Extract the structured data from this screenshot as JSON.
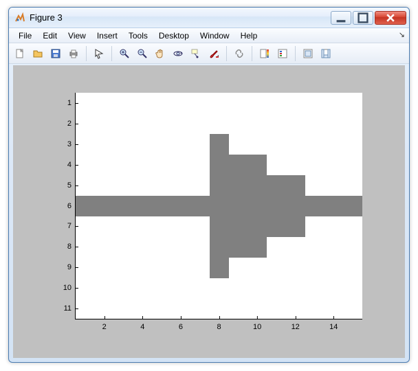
{
  "window": {
    "title": "Figure 3"
  },
  "menu": {
    "items": [
      "File",
      "Edit",
      "View",
      "Insert",
      "Tools",
      "Desktop",
      "Window",
      "Help"
    ]
  },
  "toolbar": {
    "tips": {
      "new": "New Figure",
      "open": "Open File",
      "save": "Save Figure",
      "print": "Print Figure",
      "edit": "Edit Plot",
      "zoomin": "Zoom In",
      "zoomout": "Zoom Out",
      "pan": "Pan",
      "rotate": "Rotate 3D",
      "cursor": "Data Cursor",
      "brush": "Brush",
      "link": "Link Plot",
      "colorbar": "Insert Colorbar",
      "legend": "Insert Legend",
      "hide": "Hide Plot Tools",
      "show": "Show Plot Tools"
    }
  },
  "chart_data": {
    "type": "heatmap",
    "title": "",
    "xlabel": "",
    "ylabel": "",
    "xlim": [
      0.5,
      15.5
    ],
    "ylim": [
      11.5,
      0.5
    ],
    "x_ticks": [
      2,
      4,
      6,
      8,
      10,
      12,
      14
    ],
    "y_ticks": [
      1,
      2,
      3,
      4,
      5,
      6,
      7,
      8,
      9,
      10,
      11
    ],
    "cells": [
      {
        "row": 3,
        "col": 8
      },
      {
        "row": 4,
        "col": 8
      },
      {
        "row": 4,
        "col": 9
      },
      {
        "row": 4,
        "col": 10
      },
      {
        "row": 5,
        "col": 8
      },
      {
        "row": 5,
        "col": 9
      },
      {
        "row": 5,
        "col": 10
      },
      {
        "row": 5,
        "col": 11
      },
      {
        "row": 5,
        "col": 12
      },
      {
        "row": 6,
        "col": 1
      },
      {
        "row": 6,
        "col": 2
      },
      {
        "row": 6,
        "col": 3
      },
      {
        "row": 6,
        "col": 4
      },
      {
        "row": 6,
        "col": 5
      },
      {
        "row": 6,
        "col": 6
      },
      {
        "row": 6,
        "col": 7
      },
      {
        "row": 6,
        "col": 8
      },
      {
        "row": 6,
        "col": 9
      },
      {
        "row": 6,
        "col": 10
      },
      {
        "row": 6,
        "col": 11
      },
      {
        "row": 6,
        "col": 12
      },
      {
        "row": 6,
        "col": 13
      },
      {
        "row": 6,
        "col": 14
      },
      {
        "row": 6,
        "col": 15
      },
      {
        "row": 7,
        "col": 8
      },
      {
        "row": 7,
        "col": 9
      },
      {
        "row": 7,
        "col": 10
      },
      {
        "row": 7,
        "col": 11
      },
      {
        "row": 7,
        "col": 12
      },
      {
        "row": 8,
        "col": 8
      },
      {
        "row": 8,
        "col": 9
      },
      {
        "row": 8,
        "col": 10
      },
      {
        "row": 9,
        "col": 8
      }
    ]
  }
}
